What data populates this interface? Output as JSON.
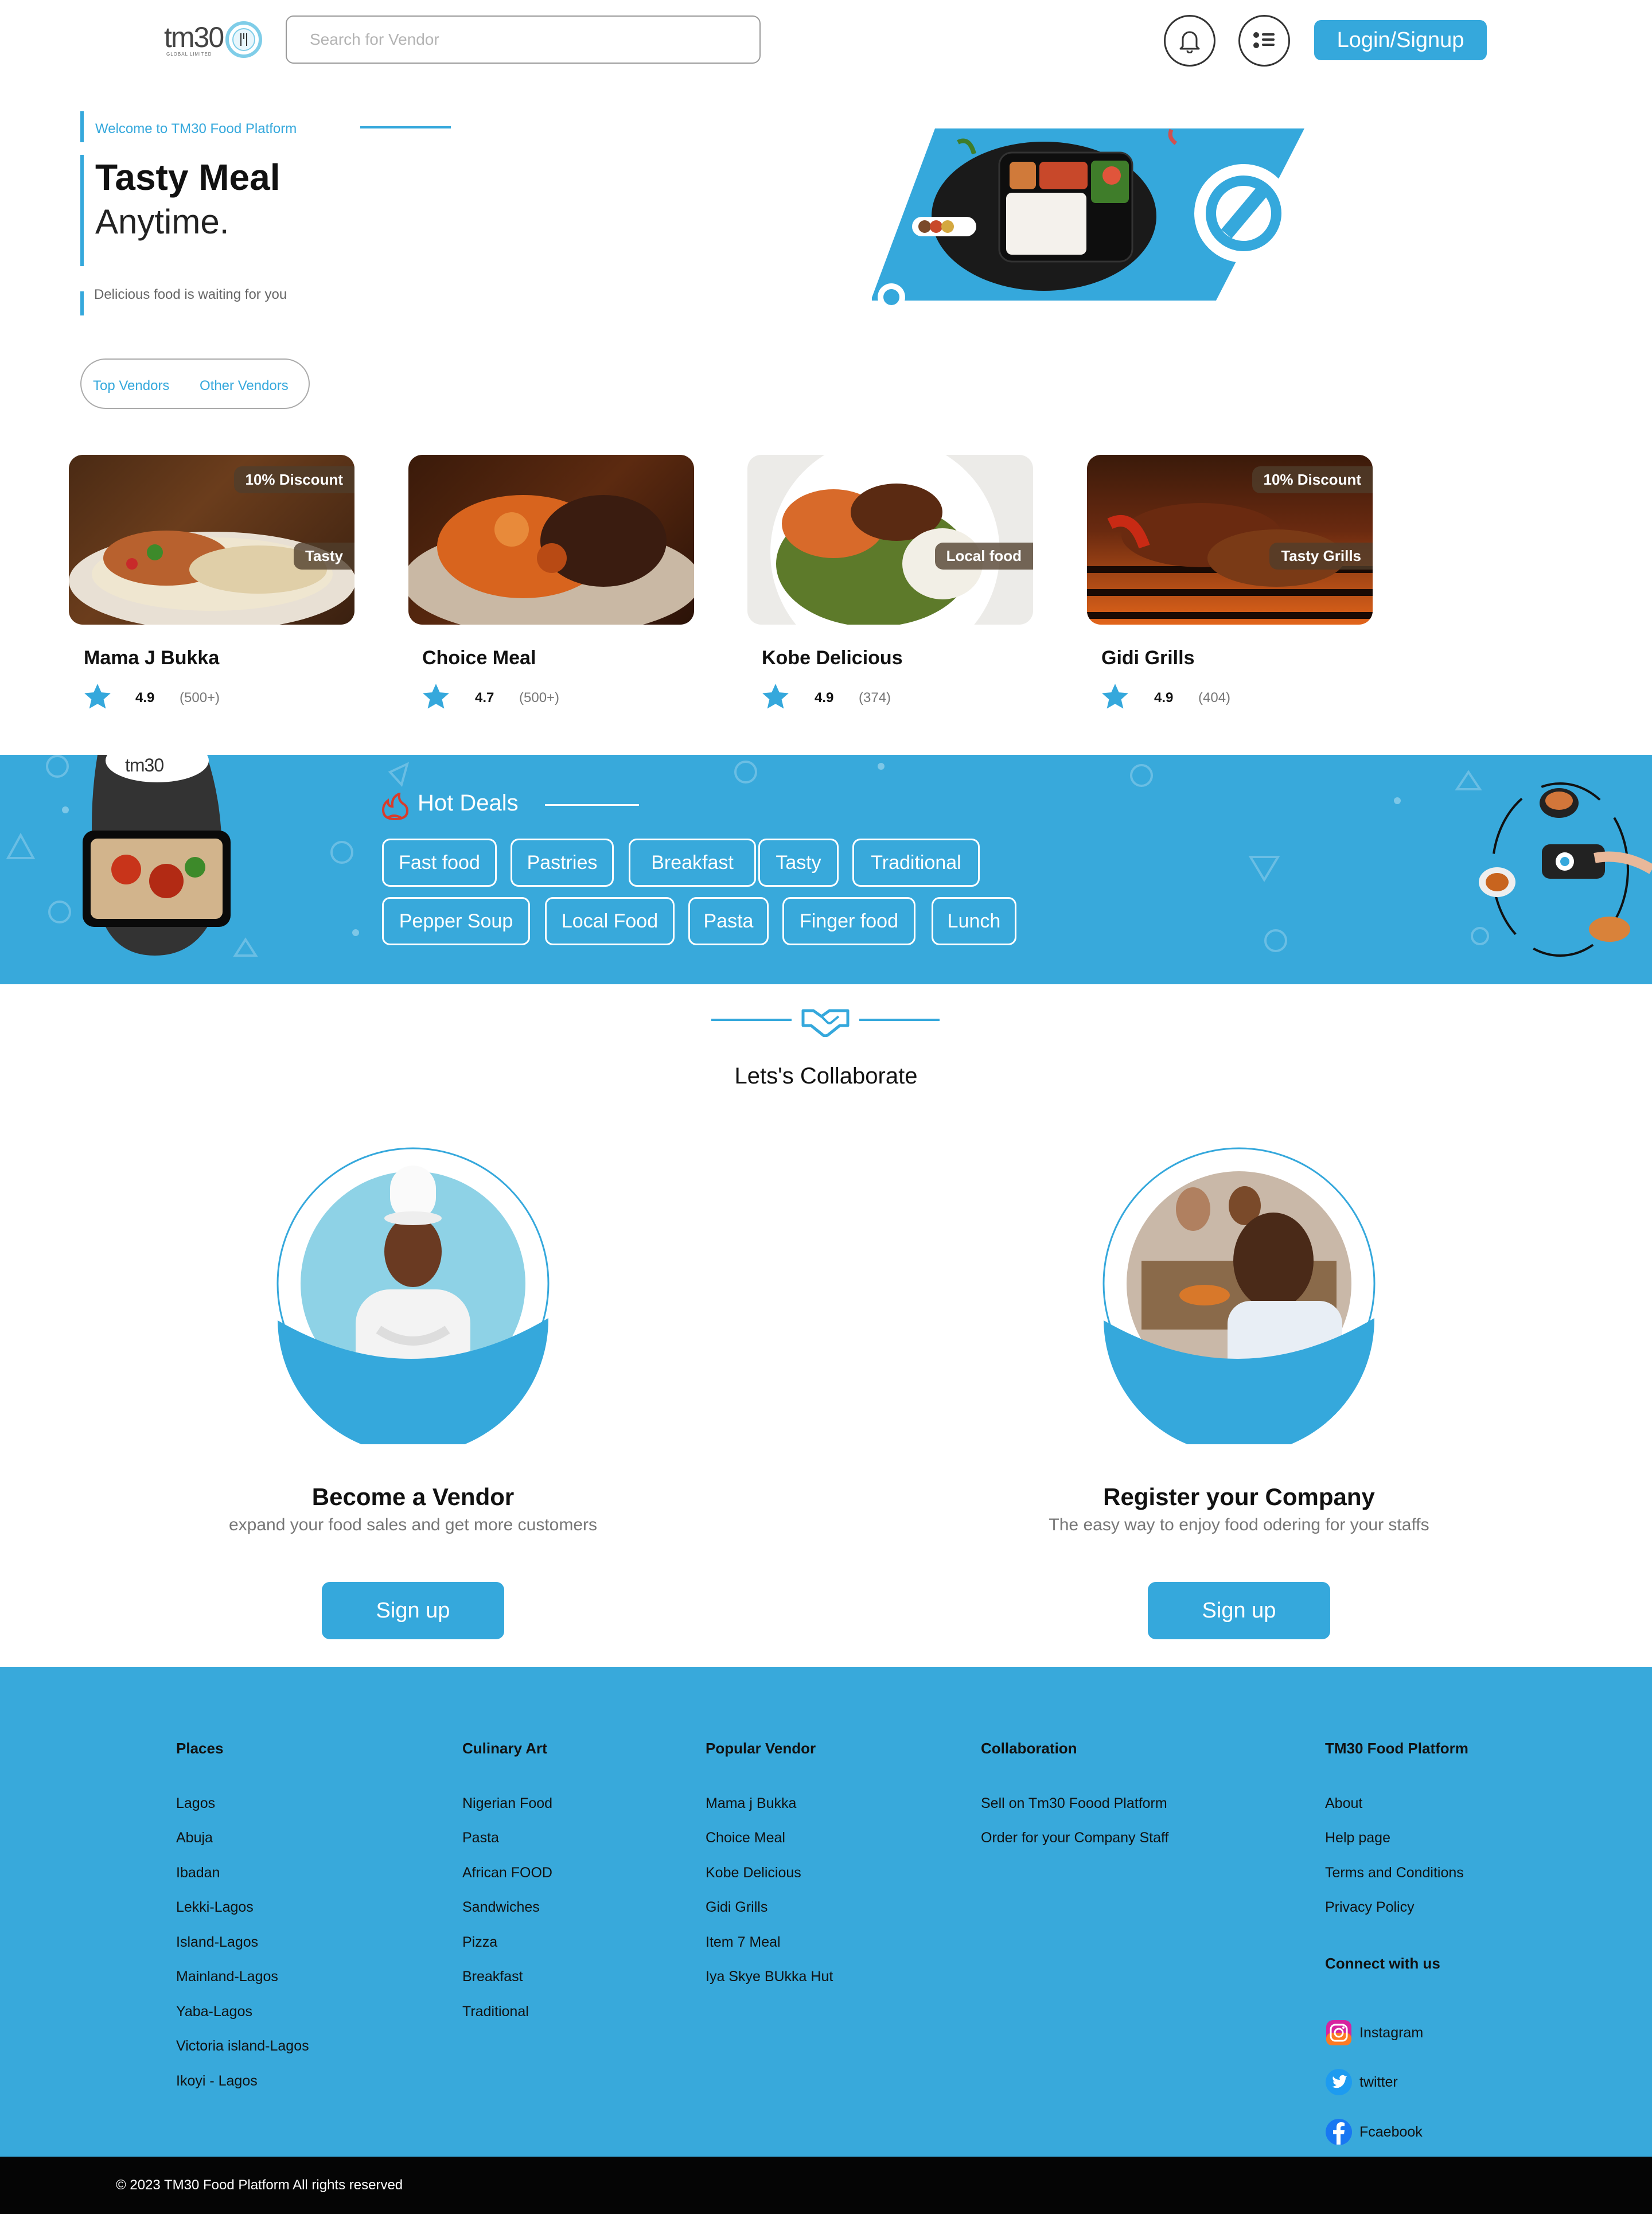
{
  "header": {
    "logo_text": "tm30",
    "logo_sub": "GLOBAL LIMITED",
    "search_placeholder": "Search for Vendor",
    "login_label": "Login/Signup"
  },
  "hero": {
    "welcome": "Welcome to TM30 Food Platform",
    "title_bold": "Tasty Meal",
    "title_light": "Anytime.",
    "subtitle": "Delicious food is waiting for you",
    "tabs": [
      "Top Vendors",
      "Other Vendors"
    ]
  },
  "vendors": [
    {
      "name": "Mama J Bukka",
      "rating": "4.9",
      "count": "(500+)",
      "badge_top": "10% Discount",
      "badge_bottom": "Tasty"
    },
    {
      "name": "Choice Meal",
      "rating": "4.7",
      "count": "(500+)",
      "badge_top": "",
      "badge_bottom": ""
    },
    {
      "name": "Kobe Delicious",
      "rating": "4.9",
      "count": "(374)",
      "badge_top": "",
      "badge_bottom": "Local food"
    },
    {
      "name": "Gidi Grills",
      "rating": "4.9",
      "count": "(404)",
      "badge_top": "10% Discount",
      "badge_bottom": "Tasty Grills"
    }
  ],
  "hot_deals": {
    "title": "Hot Deals",
    "row1": [
      "Fast food",
      "Pastries",
      "Breakfast",
      "Tasty",
      "Traditional"
    ],
    "row2": [
      "Pepper Soup",
      "Local Food",
      "Pasta",
      "Finger food",
      "Lunch"
    ]
  },
  "collaborate": {
    "title": "Lets's Collaborate",
    "vendor": {
      "title": "Become a Vendor",
      "desc": "expand your food sales and get more customers",
      "button": "Sign up"
    },
    "company": {
      "title": "Register your Company",
      "desc": "The easy way to enjoy food odering for your staffs",
      "button": "Sign up"
    }
  },
  "footer": {
    "places": {
      "title": "Places",
      "items": [
        "Lagos",
        "Abuja",
        "Ibadan",
        "Lekki-Lagos",
        "Island-Lagos",
        "Mainland-Lagos",
        "Yaba-Lagos",
        "Victoria island-Lagos",
        "Ikoyi - Lagos"
      ]
    },
    "culinary": {
      "title": "Culinary Art",
      "items": [
        "Nigerian Food",
        "Pasta",
        "African FOOD",
        "Sandwiches",
        "Pizza",
        "Breakfast",
        "Traditional"
      ]
    },
    "popular": {
      "title": "Popular Vendor",
      "items": [
        "Mama j Bukka",
        "Choice Meal",
        "Kobe Delicious",
        "Gidi Grills",
        "Item 7 Meal",
        "Iya Skye BUkka Hut"
      ]
    },
    "collaboration": {
      "title": "Collaboration",
      "items": [
        "Sell on Tm30 Foood Platform",
        "Order for your Company Staff"
      ]
    },
    "platform": {
      "title": "TM30 Food Platform",
      "items": [
        "About",
        "Help page",
        "Terms and Conditions",
        "Privacy Policy"
      ]
    },
    "connect": {
      "title": "Connect with us",
      "items": [
        "Instagram",
        "twitter",
        "Fcaebook"
      ]
    },
    "copyright": "© 2023 TM30 Food Platform All rights reserved"
  },
  "colors": {
    "accent": "#35a8dc",
    "dark": "#050505",
    "badge": "#503e2c"
  },
  "icons": [
    "bell-icon",
    "menu-list-icon",
    "star-icon",
    "fire-icon",
    "handshake-icon",
    "instagram-icon",
    "twitter-icon",
    "facebook-icon"
  ]
}
